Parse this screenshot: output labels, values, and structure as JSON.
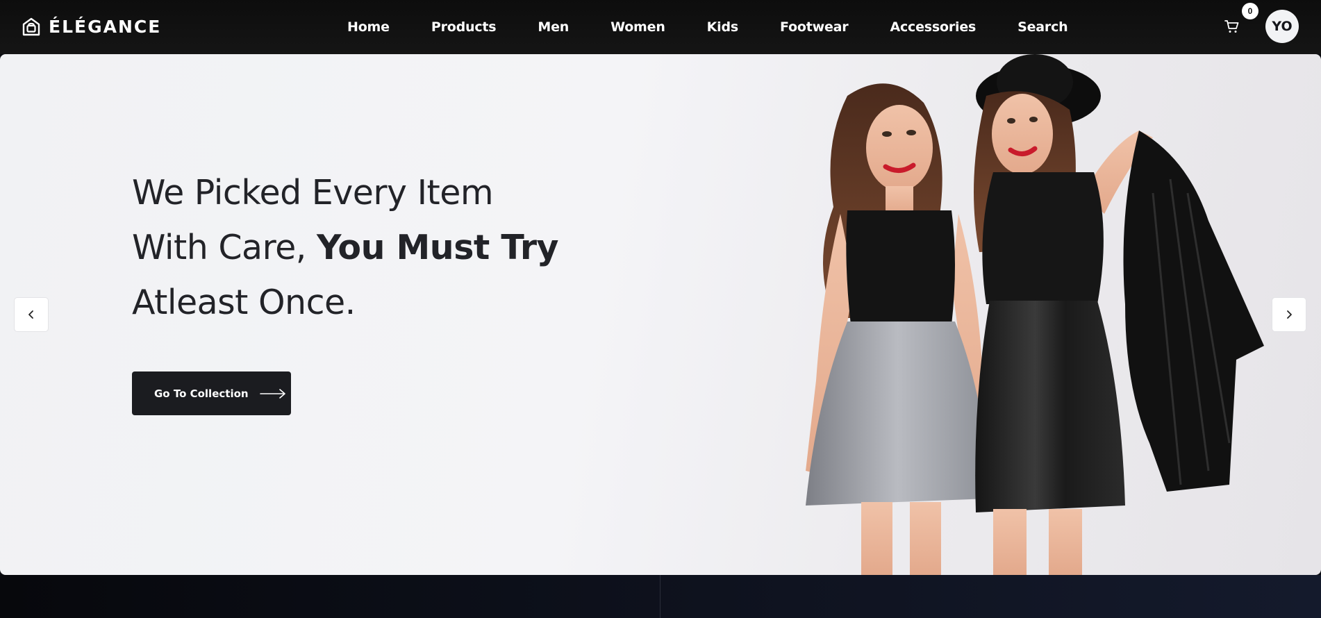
{
  "brand": {
    "name": "ÉLÉGANCE",
    "icon": "house-shop-icon"
  },
  "nav": {
    "links": [
      "Home",
      "Products",
      "Men",
      "Women",
      "Kids",
      "Footwear",
      "Accessories",
      "Search"
    ]
  },
  "cart": {
    "icon": "shopping-cart-icon",
    "count": "0"
  },
  "user": {
    "initials": "YO"
  },
  "hero": {
    "line1": "We Picked Every Item",
    "line2_regular": "With Care, ",
    "line2_bold": "You Must Try",
    "line3": "Atleast Once.",
    "cta_label": "Go To Collection",
    "cta_icon": "long-arrow-right-icon",
    "prev_icon": "chevron-left-icon",
    "next_icon": "chevron-right-icon",
    "image": "two-models-photo"
  },
  "colors": {
    "header_bg": "#111111",
    "hero_bg": "#f2f2f5",
    "text_dark": "#222328",
    "button_bg": "#1b1c20",
    "footer_bg": "#0b0d14"
  }
}
